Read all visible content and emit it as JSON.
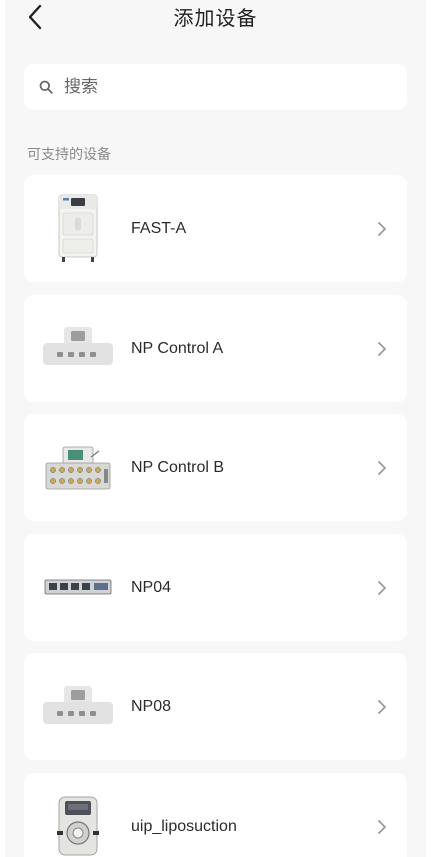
{
  "header": {
    "title": "添加设备",
    "back_icon": "chevron-left-icon"
  },
  "search": {
    "placeholder": "搜索",
    "value": "",
    "icon": "search-icon"
  },
  "section": {
    "label": "可支持的设备"
  },
  "devices": [
    {
      "name": "FAST-A",
      "icon": "fast-a-device-image"
    },
    {
      "name": "NP Control A",
      "icon": "np-control-a-device-image"
    },
    {
      "name": "NP Control B",
      "icon": "np-control-b-device-image"
    },
    {
      "name": "NP04",
      "icon": "np04-device-image"
    },
    {
      "name": "NP08",
      "icon": "np08-device-image"
    },
    {
      "name": "uip_liposuction",
      "icon": "uip-liposuction-device-image"
    }
  ],
  "colors": {
    "background": "#f7f7f7",
    "card": "#ffffff",
    "text": "#2b2b2b",
    "muted": "#8a8a8a",
    "chevron": "#9a9a9a"
  }
}
